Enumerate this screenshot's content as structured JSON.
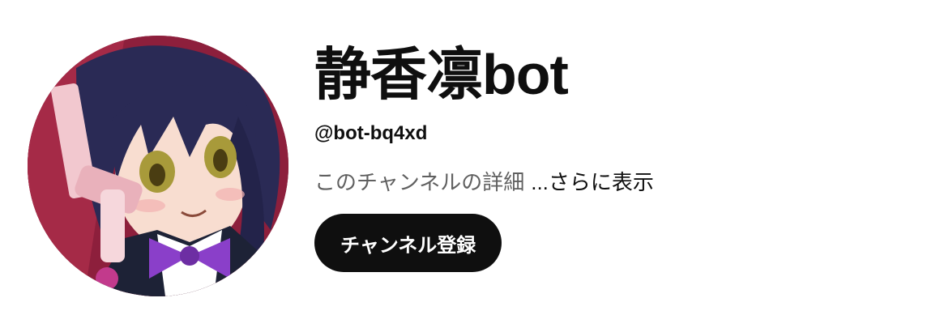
{
  "channel": {
    "name": "静香凛bot",
    "handle": "@bot-bq4xd",
    "description": "このチャンネルの詳細",
    "more_label": "...さらに表示",
    "subscribe_label": "チャンネル登録"
  },
  "avatar": {
    "icon": "channel-avatar",
    "colors": {
      "background": "#8d1f3c",
      "hair": "#2a2a55",
      "bow": "#8a3fc9",
      "skin": "#f8ddd0"
    }
  },
  "colors": {
    "text_primary": "#0f0f0f",
    "text_secondary": "#606060",
    "button_bg": "#0f0f0f",
    "button_text": "#ffffff"
  }
}
